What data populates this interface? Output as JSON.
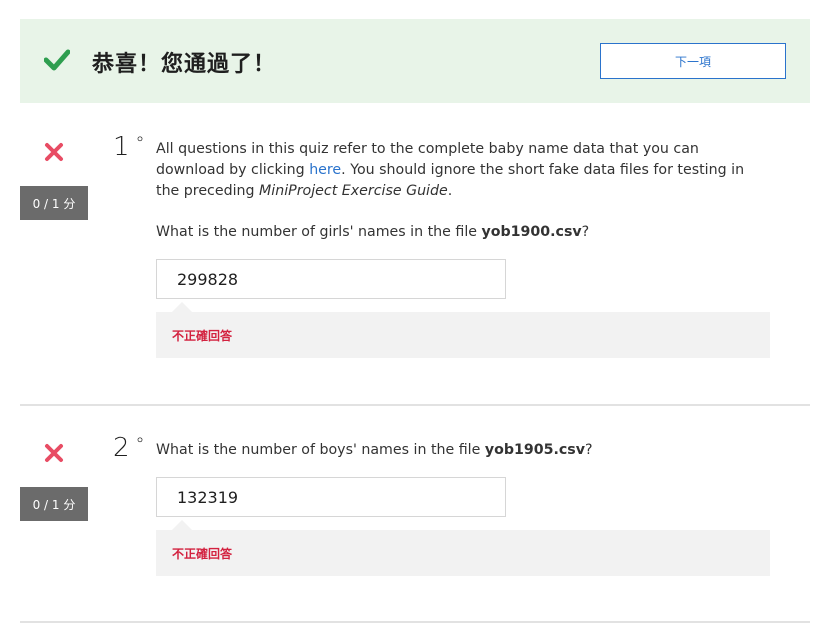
{
  "banner": {
    "message": "恭喜！您通過了！",
    "next_label": "下一項",
    "check_icon": "check-icon",
    "color": "#2e9e4f"
  },
  "questions": [
    {
      "number": "1",
      "dot": "°",
      "score": "0 / 1 分",
      "text_part1": "All questions in this quiz refer to the complete baby name data that you can download by clicking ",
      "link_text": "here",
      "text_part2": ". You should ignore the short fake data files for testing in the preceding ",
      "italic_text": "MiniProject Exercise Guide",
      "text_part3": ".",
      "prompt_prefix": "What is the number of girls' names in the file ",
      "prompt_file": "yob1900.csv",
      "prompt_suffix": "?",
      "answer": "299828",
      "feedback": "不正確回答"
    },
    {
      "number": "2",
      "dot": "°",
      "score": "0 / 1 分",
      "prompt_prefix": "What is the number of boys' names in the file ",
      "prompt_file": "yob1905.csv",
      "prompt_suffix": "?",
      "answer": "132319",
      "feedback": "不正確回答"
    }
  ],
  "colors": {
    "banner_bg": "#e8f4e8",
    "accent": "#2a73cc",
    "incorrect": "#d3213f",
    "x_icon": "#e84c64",
    "badge_bg": "#6b6b6b"
  }
}
